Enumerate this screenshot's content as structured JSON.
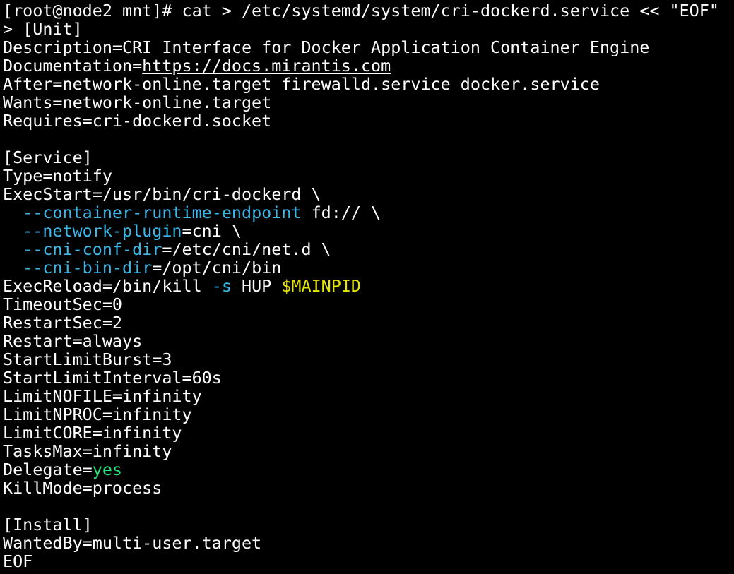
{
  "terminal": {
    "colors": {
      "background": "#000000",
      "text": "#ffffff",
      "flag": "#3bb8e8",
      "variable": "#e6e600",
      "value_highlight": "#22e07a"
    },
    "lines": [
      {
        "segments": [
          {
            "text": "[root@node2 mnt]# cat > /etc/systemd/system/cri-dockerd.service << \"EOF\""
          }
        ]
      },
      {
        "segments": [
          {
            "text": "> [Unit]"
          }
        ]
      },
      {
        "segments": [
          {
            "text": "Description=CRI Interface for Docker Application Container Engine"
          }
        ]
      },
      {
        "segments": [
          {
            "text": "Documentation="
          },
          {
            "text": "https://docs.mirantis.com",
            "style": "link"
          }
        ]
      },
      {
        "segments": [
          {
            "text": "After=network-online.target firewalld.service docker.service"
          }
        ]
      },
      {
        "segments": [
          {
            "text": "Wants=network-online.target"
          }
        ]
      },
      {
        "segments": [
          {
            "text": "Requires=cri-dockerd.socket"
          }
        ]
      },
      {
        "segments": []
      },
      {
        "segments": [
          {
            "text": "[Service]"
          }
        ]
      },
      {
        "segments": [
          {
            "text": "Type=notify"
          }
        ]
      },
      {
        "segments": [
          {
            "text": "ExecStart=/usr/bin/cri-dockerd \\"
          }
        ]
      },
      {
        "segments": [
          {
            "text": "  "
          },
          {
            "text": "--container-runtime-endpoint",
            "style": "cyan"
          },
          {
            "text": " fd:// \\"
          }
        ]
      },
      {
        "segments": [
          {
            "text": "  "
          },
          {
            "text": "--network-plugin",
            "style": "cyan"
          },
          {
            "text": "=cni \\"
          }
        ]
      },
      {
        "segments": [
          {
            "text": "  "
          },
          {
            "text": "--cni-conf-dir",
            "style": "cyan"
          },
          {
            "text": "=/etc/cni/net.d \\"
          }
        ]
      },
      {
        "segments": [
          {
            "text": "  "
          },
          {
            "text": "--cni-bin-dir",
            "style": "cyan"
          },
          {
            "text": "=/opt/cni/bin"
          }
        ]
      },
      {
        "segments": [
          {
            "text": "ExecReload=/bin/kill "
          },
          {
            "text": "-s",
            "style": "cyan"
          },
          {
            "text": " HUP "
          },
          {
            "text": "$MAINPID",
            "style": "yellow"
          }
        ]
      },
      {
        "segments": [
          {
            "text": "TimeoutSec=0"
          }
        ]
      },
      {
        "segments": [
          {
            "text": "RestartSec=2"
          }
        ]
      },
      {
        "segments": [
          {
            "text": "Restart=always"
          }
        ]
      },
      {
        "segments": [
          {
            "text": "StartLimitBurst=3"
          }
        ]
      },
      {
        "segments": [
          {
            "text": "StartLimitInterval=60s"
          }
        ]
      },
      {
        "segments": [
          {
            "text": "LimitNOFILE=infinity"
          }
        ]
      },
      {
        "segments": [
          {
            "text": "LimitNPROC=infinity"
          }
        ]
      },
      {
        "segments": [
          {
            "text": "LimitCORE=infinity"
          }
        ]
      },
      {
        "segments": [
          {
            "text": "TasksMax=infinity"
          }
        ]
      },
      {
        "segments": [
          {
            "text": "Delegate="
          },
          {
            "text": "yes",
            "style": "green"
          }
        ]
      },
      {
        "segments": [
          {
            "text": "KillMode=process"
          }
        ]
      },
      {
        "segments": []
      },
      {
        "segments": [
          {
            "text": "[Install]"
          }
        ]
      },
      {
        "segments": [
          {
            "text": "WantedBy=multi-user.target"
          }
        ]
      },
      {
        "segments": [
          {
            "text": "EOF"
          }
        ]
      }
    ]
  }
}
